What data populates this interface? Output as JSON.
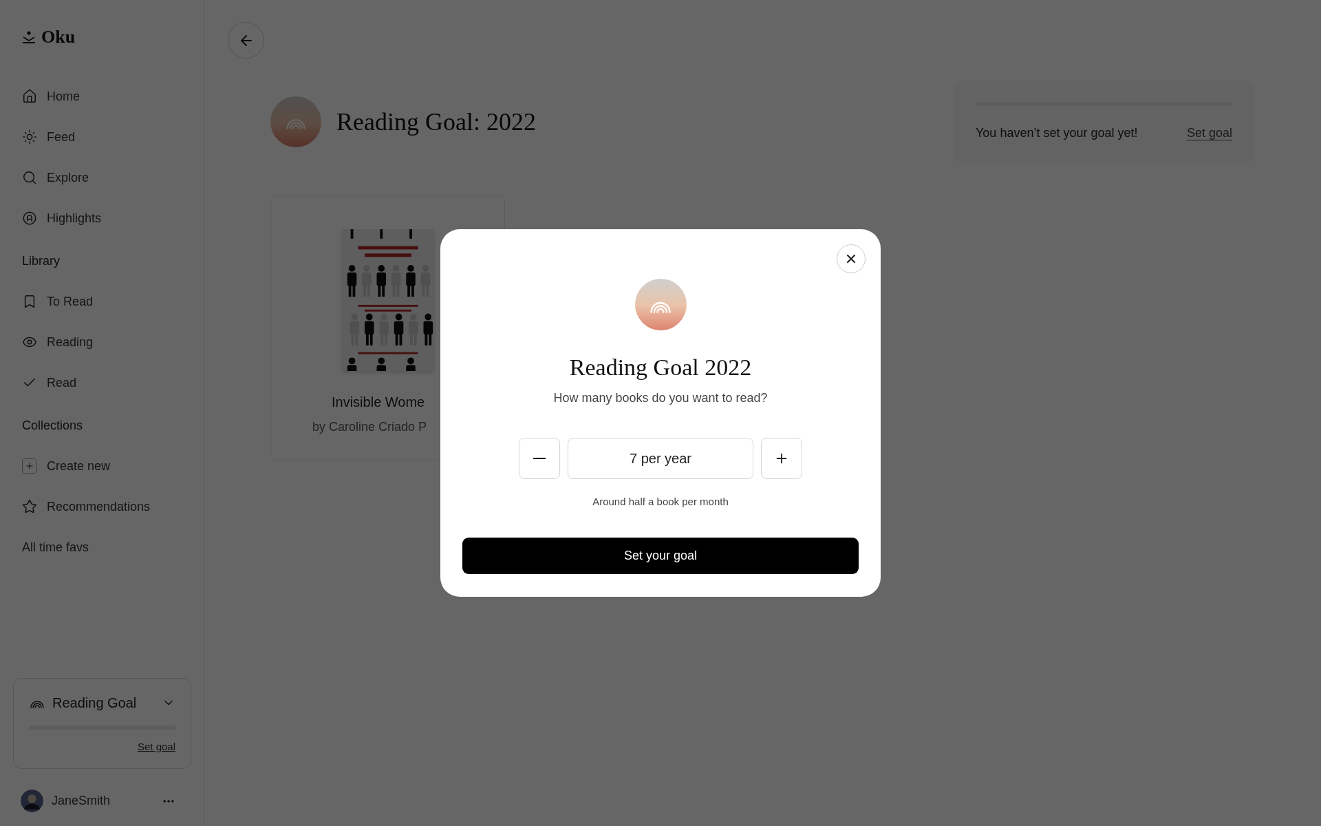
{
  "logo": "Oku",
  "sidebar": {
    "nav": [
      {
        "label": "Home"
      },
      {
        "label": "Feed"
      },
      {
        "label": "Explore"
      },
      {
        "label": "Highlights"
      }
    ],
    "sections": [
      {
        "heading": "Library",
        "items": [
          {
            "label": "To Read"
          },
          {
            "label": "Reading"
          },
          {
            "label": "Read"
          }
        ]
      },
      {
        "heading": "Collections",
        "items": [
          {
            "label": "Create new"
          },
          {
            "label": "Recommendations"
          },
          {
            "label": "All time favs"
          }
        ]
      }
    ],
    "goal_widget": {
      "title": "Reading Goal",
      "level": 0,
      "link": "Set goal"
    },
    "user": {
      "name": "JaneSmith"
    }
  },
  "page": {
    "title": "Reading Goal: 2022",
    "goal_card": {
      "level": 0,
      "message": "You haven’t set your goal yet!",
      "link": "Set goal"
    },
    "books": [
      {
        "title": "Invisible Wome",
        "author": "by Caroline Criado P"
      }
    ]
  },
  "dialog": {
    "title": "Reading Goal 2022",
    "question": "How many books do you want to read?",
    "value": "7 per year",
    "hint": "Around half a book per month",
    "submit": "Set your goal"
  }
}
